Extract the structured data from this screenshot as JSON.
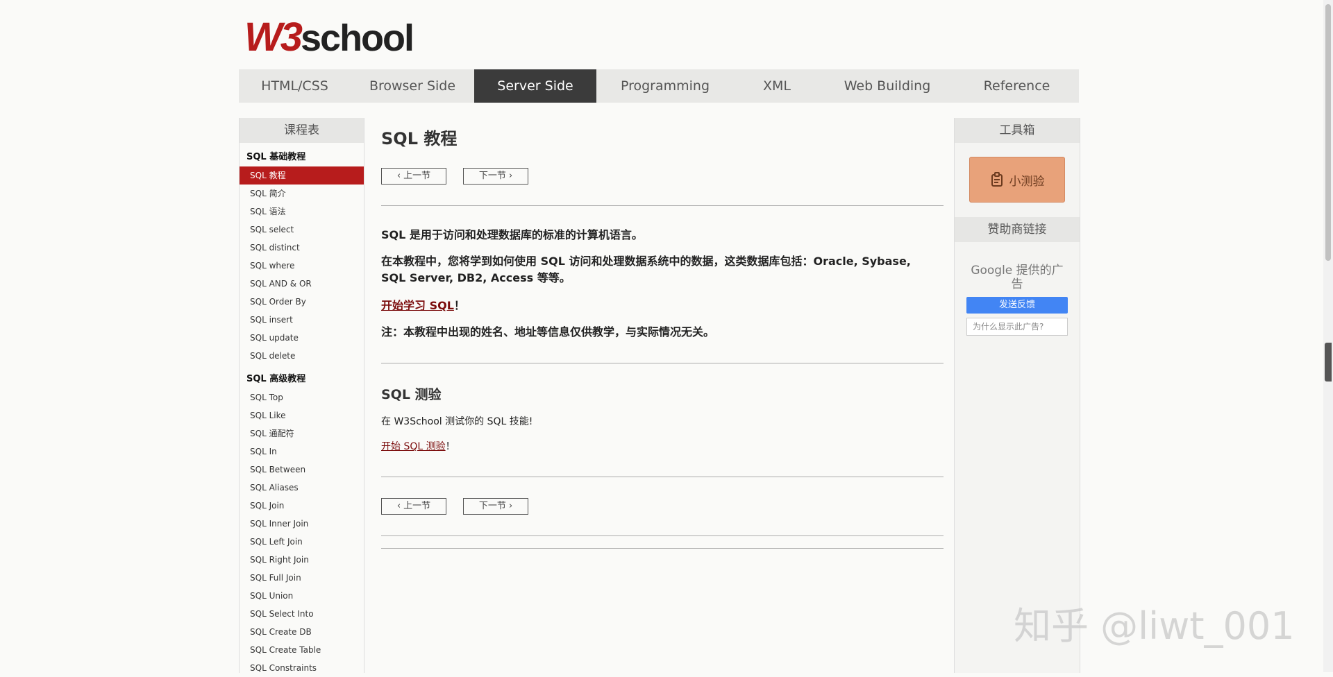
{
  "logo": {
    "w3": "W3",
    "school": "school"
  },
  "nav": [
    "HTML/CSS",
    "Browser Side",
    "Server Side",
    "Programming",
    "XML",
    "Web Building",
    "Reference"
  ],
  "nav_active": "Server Side",
  "left": {
    "title": "课程表",
    "group1": "SQL 基础教程",
    "items1": [
      "SQL 教程",
      "SQL 简介",
      "SQL 语法",
      "SQL select",
      "SQL distinct",
      "SQL where",
      "SQL AND & OR",
      "SQL Order By",
      "SQL insert",
      "SQL update",
      "SQL delete"
    ],
    "group2": "SQL 高级教程",
    "items2": [
      "SQL Top",
      "SQL Like",
      "SQL 通配符",
      "SQL In",
      "SQL Between",
      "SQL Aliases",
      "SQL Join",
      "SQL Inner Join",
      "SQL Left Join",
      "SQL Right Join",
      "SQL Full Join",
      "SQL Union",
      "SQL Select Into",
      "SQL Create DB",
      "SQL Create Table",
      "SQL Constraints"
    ]
  },
  "main": {
    "title": "SQL 教程",
    "prev": "上一节",
    "next": "下一节",
    "intro": "SQL 是用于访问和处理数据库的标准的计算机语言。",
    "desc": "在本教程中，您将学到如何使用 SQL 访问和处理数据系统中的数据，这类数据库包括：Oracle, Sybase, SQL Server, DB2, Access 等等。",
    "start_link": "开始学习 SQL",
    "start_suffix": "！",
    "note": "注：本教程中出现的姓名、地址等信息仅供教学，与实际情况无关。",
    "quiz_title": "SQL 测验",
    "quiz_text": "在 W3School 测试你的 SQL 技能!",
    "quiz_link": "开始 SQL 测验",
    "quiz_suffix": "！"
  },
  "right": {
    "toolbox": "工具箱",
    "quiz_btn": "小测验",
    "sponsor": "赞助商链接",
    "google": "Google 提供的广告",
    "feedback": "发送反馈",
    "why": "为什么显示此广告?"
  },
  "watermark": "知乎 @liwt_001",
  "colors": {
    "accent": "#b71c1c",
    "nav_active": "#3b3b3b",
    "quiz": "#e8a27a",
    "link": "#7b0c0c",
    "google_blue": "#4285f4"
  }
}
